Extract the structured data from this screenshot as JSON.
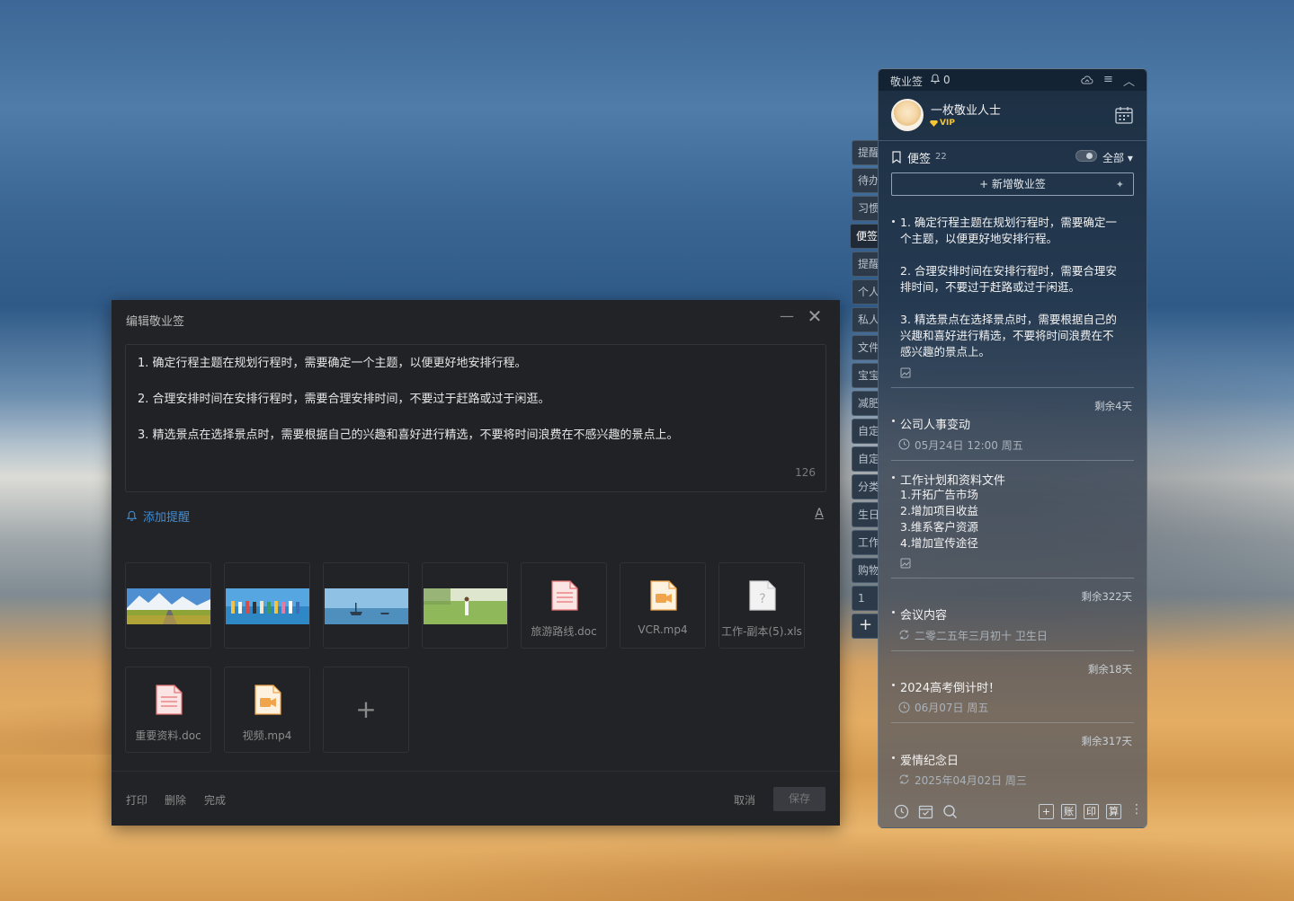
{
  "dialog": {
    "title": "编辑敬业签",
    "minimize": "—",
    "close": "✕",
    "lines": [
      "1. 确定行程主题在规划行程时，需要确定一个主题，以便更好地安排行程。",
      "2. 合理安排时间在安排行程时，需要合理安排时间，不要过于赶路或过于闲逛。",
      "3. 精选景点在选择景点时，需要根据自己的兴趣和喜好进行精选，不要将时间浪费在不感兴趣的景点上。"
    ],
    "char_count": "126",
    "add_reminder": "添加提醒",
    "font_icon": "A",
    "attachments": {
      "file1": "旅游路线.doc",
      "file2": "VCR.mp4",
      "file3": "工作-副本(5).xls",
      "file4": "重要资料.doc",
      "file5": "视频.mp4",
      "add": "+"
    },
    "footer": {
      "print": "打印",
      "delete": "删除",
      "done": "完成",
      "cancel": "取消",
      "save": "保存"
    }
  },
  "tabs": [
    "提醒",
    "待办",
    "习惯",
    "便签",
    "提醒",
    "个人",
    "私人",
    "文件",
    "宝宝",
    "减肥",
    "自定",
    "自定",
    "分类",
    "生日",
    "工作",
    "购物",
    "1"
  ],
  "tab_add": "+",
  "panel": {
    "app_name": "敬业签",
    "reminder_count": "0",
    "menu": "≡",
    "collapse": "︿",
    "username": "一枚敬业人士",
    "vip": "VIP",
    "section": "便签",
    "section_count": "22",
    "filter": "全部 ▾",
    "new_note": "+ 新增敬业签",
    "sparkle": "✦",
    "note1": [
      "1. 确定行程主题在规划行程时，需要确定一",
      "个主题，以便更好地安排行程。",
      "2. 合理安排时间在安排行程时，需要合理安",
      "排时间，不要过于赶路或过于闲逛。",
      "3. 精选景点在选择景点时，需要根据自己的",
      "兴趣和喜好进行精选，不要将时间浪费在不",
      "感兴趣的景点上。"
    ],
    "note2": {
      "remain": "剩余4天",
      "title": "公司人事变动",
      "date": "05月24日 12:00 周五"
    },
    "note3": {
      "title": "工作计划和资料文件",
      "lines": [
        "1.开拓广告市场",
        "2.增加项目收益",
        "3.维系客户资源",
        "4.增加宣传途径"
      ]
    },
    "note4": {
      "remain": "剩余322天",
      "title": "会议内容",
      "date": "二零二五年三月初十 卫生日"
    },
    "note5": {
      "remain": "剩余18天",
      "title": "2024高考倒计时！",
      "date": "06月07日 周五"
    },
    "note6": {
      "remain": "剩余317天",
      "title": "爱情纪念日",
      "date": "2025年04月02日 周三"
    },
    "bottom": {
      "add": "+",
      "account": "账",
      "print": "印",
      "calc": "算",
      "more": "⋮"
    }
  }
}
